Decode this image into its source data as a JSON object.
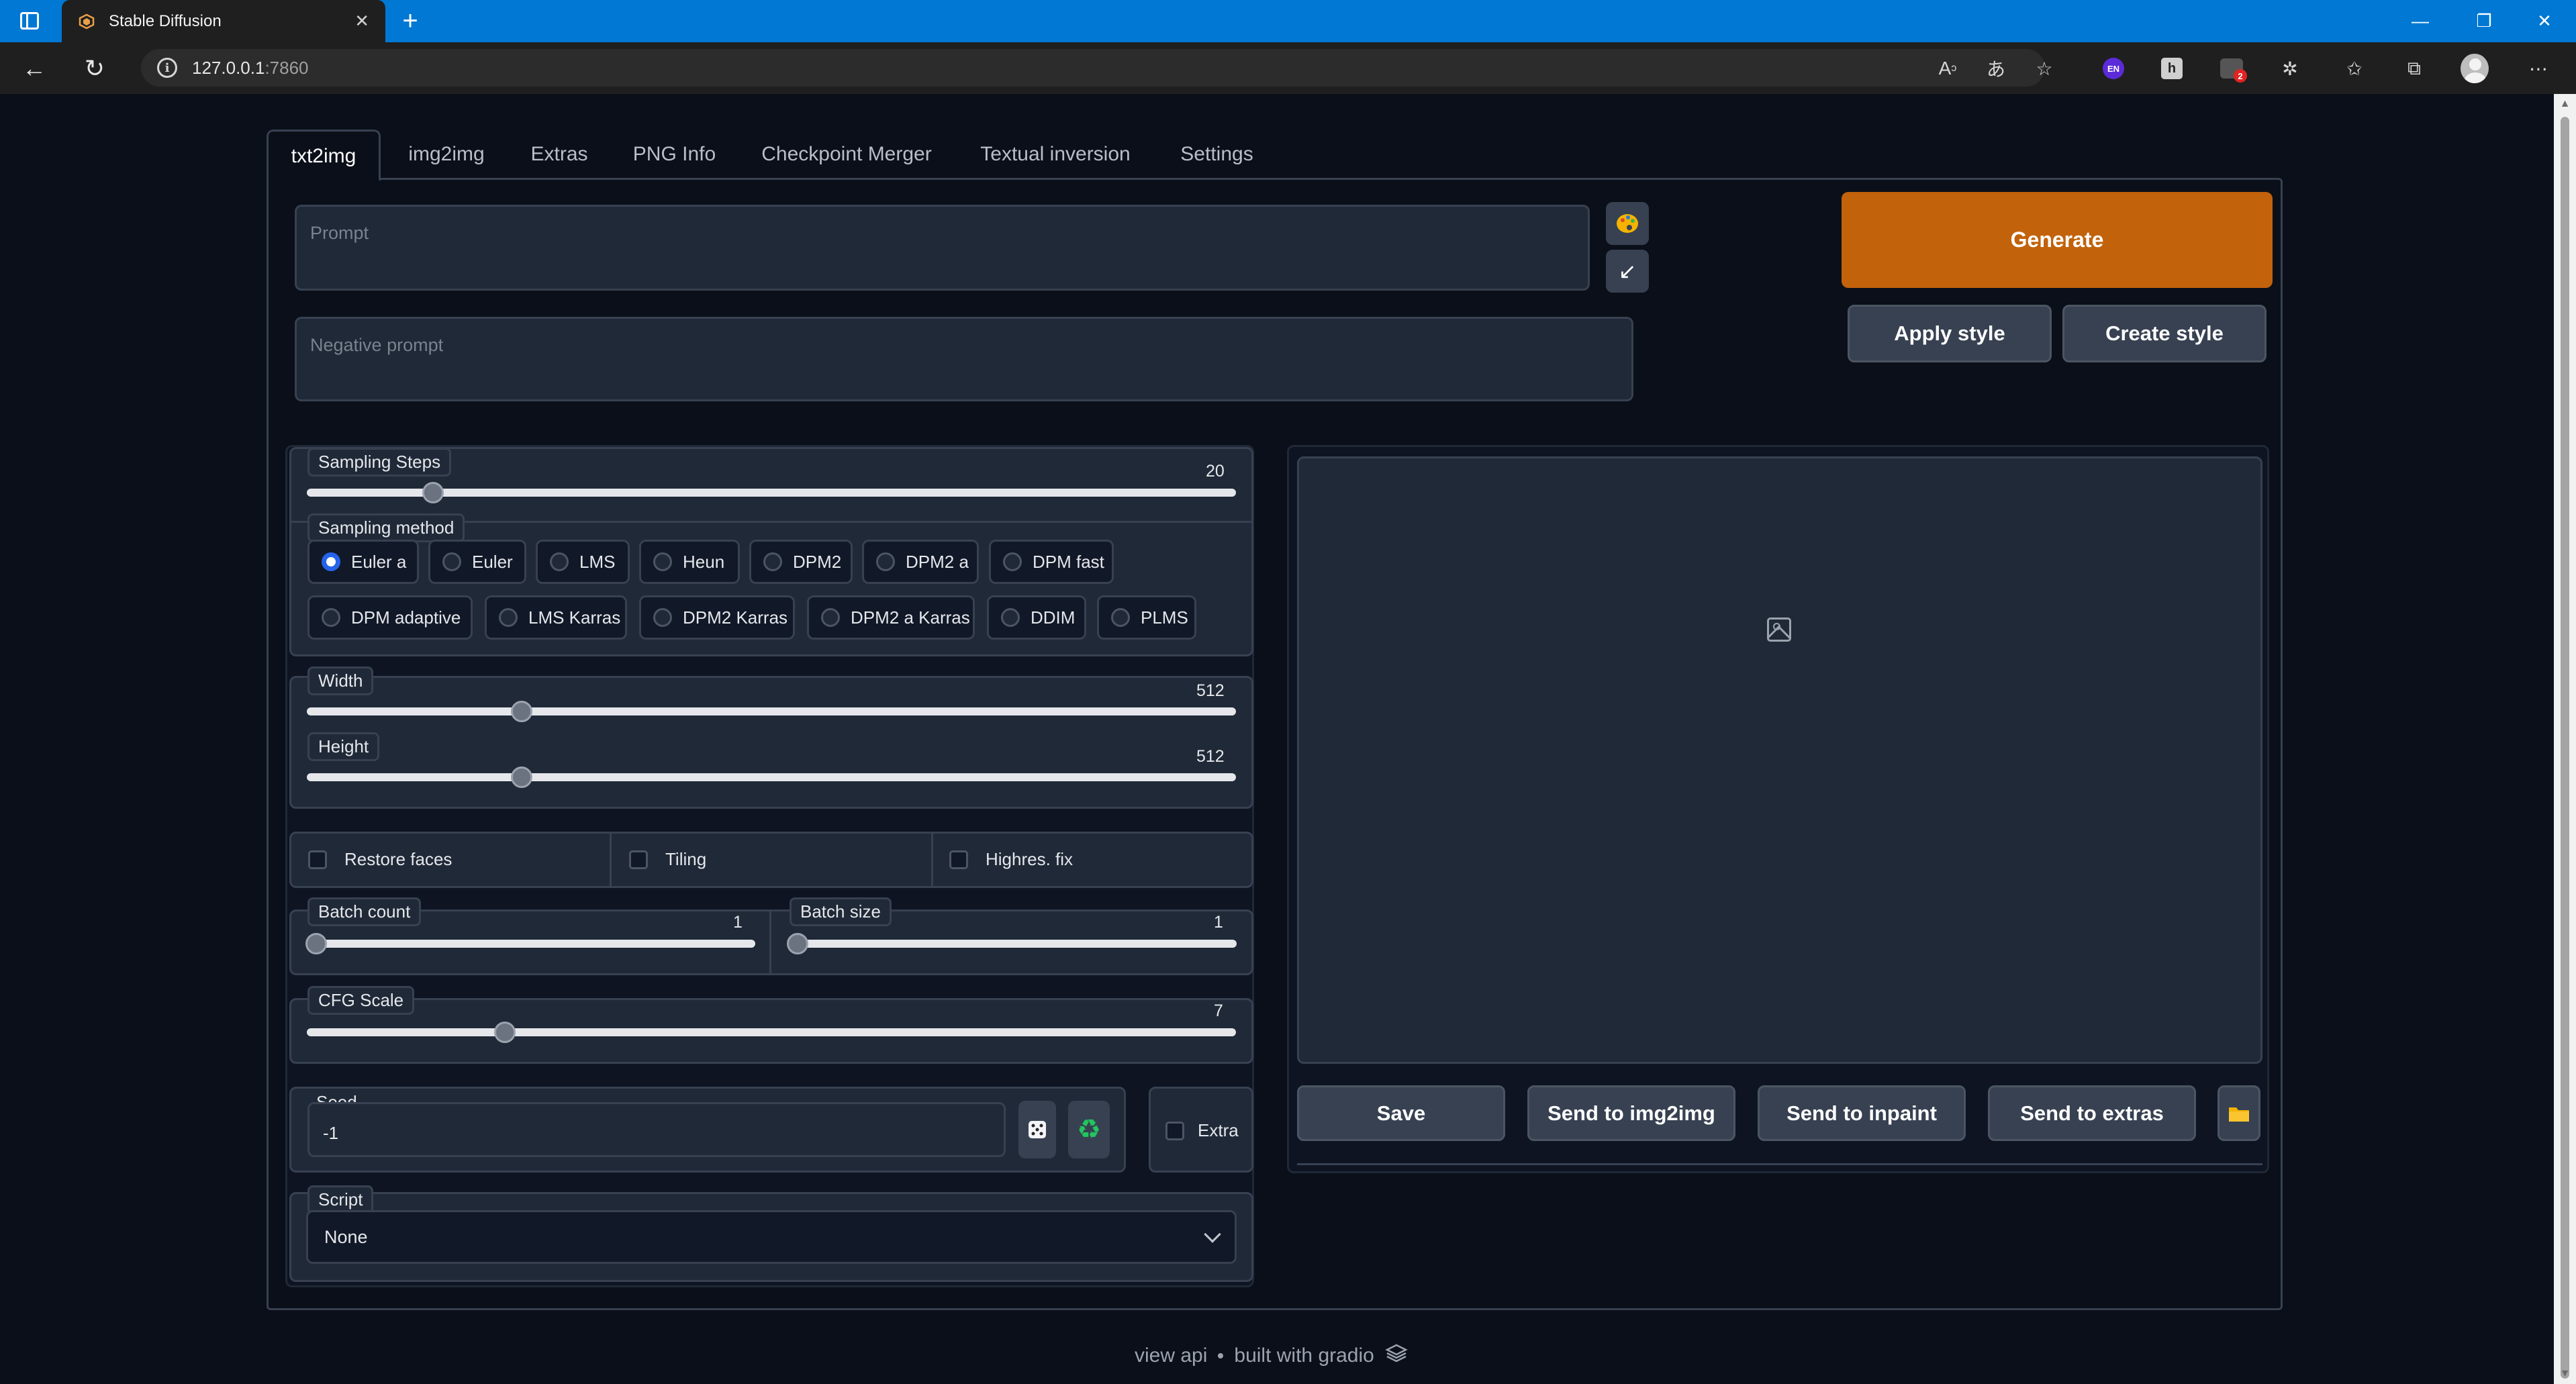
{
  "browser": {
    "tab_title": "Stable Diffusion",
    "url_host": "127.0.0.1",
    "url_port": ":7860",
    "extensions": {
      "en_badge": "EN",
      "h_badge": "h",
      "alert_count": "2"
    }
  },
  "tabs": [
    "txt2img",
    "img2img",
    "Extras",
    "PNG Info",
    "Checkpoint Merger",
    "Textual inversion",
    "Settings"
  ],
  "active_tab": "txt2img",
  "prompt": {
    "placeholder": "Prompt",
    "negative_placeholder": "Negative prompt"
  },
  "buttons": {
    "generate": "Generate",
    "apply_style": "Apply style",
    "create_style": "Create style"
  },
  "sampling_steps": {
    "label": "Sampling Steps",
    "value": "20",
    "min": 1,
    "max": 150
  },
  "sampling_method": {
    "label": "Sampling method",
    "options": [
      "Euler a",
      "Euler",
      "LMS",
      "Heun",
      "DPM2",
      "DPM2 a",
      "DPM fast",
      "DPM adaptive",
      "LMS Karras",
      "DPM2 Karras",
      "DPM2 a Karras",
      "DDIM",
      "PLMS"
    ],
    "selected": "Euler a"
  },
  "width": {
    "label": "Width",
    "value": "512",
    "min": 64,
    "max": 2048
  },
  "height": {
    "label": "Height",
    "value": "512",
    "min": 64,
    "max": 2048
  },
  "checkboxes": {
    "restore_faces": "Restore faces",
    "tiling": "Tiling",
    "highres_fix": "Highres. fix",
    "extra": "Extra"
  },
  "batch_count": {
    "label": "Batch count",
    "value": "1",
    "min": 1,
    "max": 100
  },
  "batch_size": {
    "label": "Batch size",
    "value": "1",
    "min": 1,
    "max": 8
  },
  "cfg_scale": {
    "label": "CFG Scale",
    "value": "7",
    "min": 1,
    "max": 30
  },
  "seed": {
    "label": "Seed",
    "value": "-1"
  },
  "script": {
    "label": "Script",
    "value": "None"
  },
  "output_buttons": {
    "save": "Save",
    "send_img2img": "Send to img2img",
    "send_inpaint": "Send to inpaint",
    "send_extras": "Send to extras"
  },
  "footer": {
    "view_api": "view api",
    "built_with": "built with gradio"
  },
  "colors": {
    "accent": "#c2620b",
    "radio_selected": "#2563eb",
    "background": "#0b0f19",
    "panel": "#1f2937",
    "border": "#374151"
  },
  "icons": {
    "paint": "paint-palette-icon",
    "arrow": "arrow-down-left-icon",
    "dice": "dice-icon",
    "recycle": "recycle-icon",
    "folder": "folder-icon"
  }
}
